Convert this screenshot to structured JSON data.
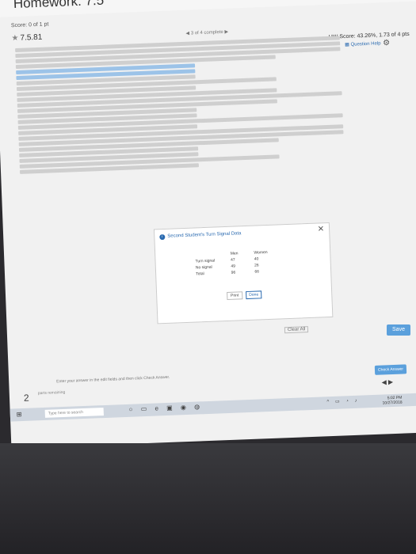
{
  "header": {
    "title": "Homework: 7.5",
    "save": "Save"
  },
  "score": {
    "line": "Score: 0 of 1 pt",
    "question": "7.5.81",
    "progress": "3 of 4 complete",
    "hw_score": "HW Score: 43.26%, 1.73 of 4 pts",
    "help": "Question Help"
  },
  "panel": {
    "title": "Second Student's Turn Signal Data",
    "columns": [
      "",
      "Men",
      "Women"
    ],
    "rows": [
      [
        "Turn signal",
        "47",
        "40"
      ],
      [
        "No signal",
        "49",
        "26"
      ],
      [
        "Total",
        "96",
        "66"
      ]
    ],
    "print": "Print",
    "done": "Done"
  },
  "footer": {
    "clear": "Clear All",
    "hint": "Enter your answer in the edit fields and then click Check Answer.",
    "check": "Check Answer",
    "parts_num": "2",
    "parts_label": "parts remaining"
  },
  "taskbar": {
    "search": "Type here to search",
    "time": "5:02 PM",
    "date": "10/27/2018"
  }
}
